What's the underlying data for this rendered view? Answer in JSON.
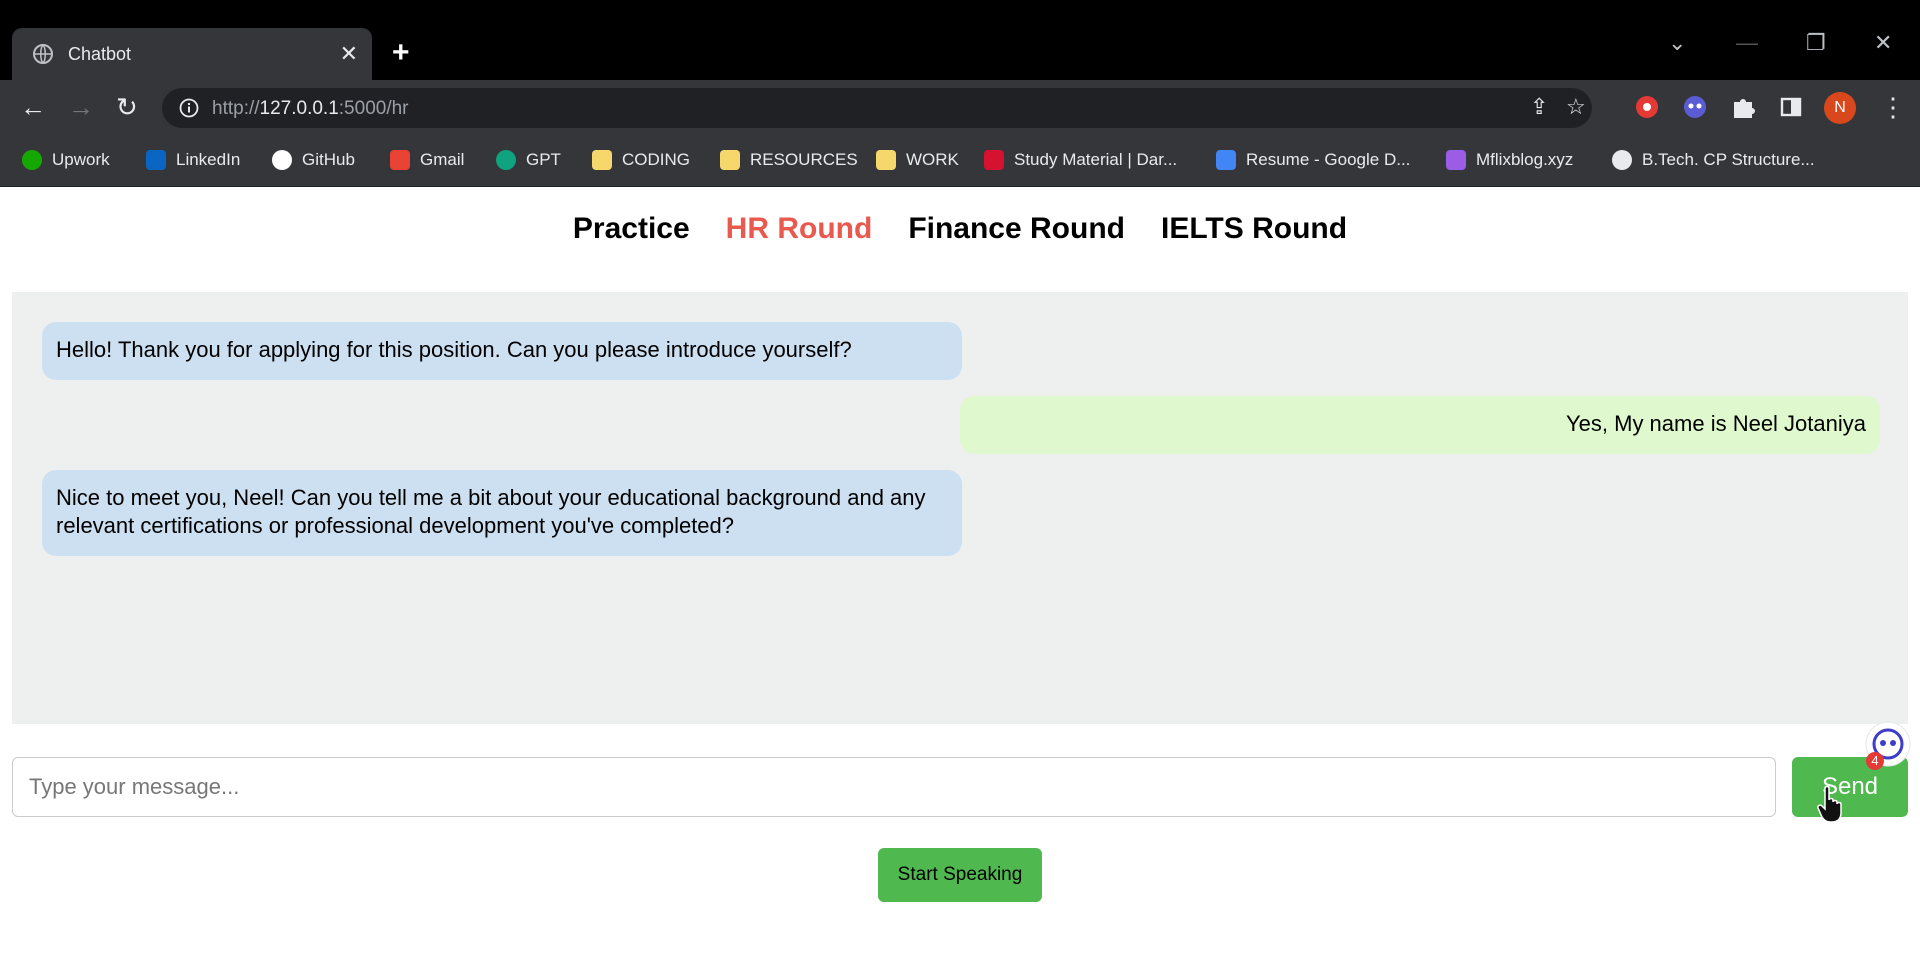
{
  "browser": {
    "tab_title": "Chatbot",
    "tab_close": "✕",
    "new_tab": "+",
    "url_prefix": "http://",
    "url_host": "127.0.0.1",
    "url_rest": ":5000/hr",
    "profile_initial": "N",
    "bookmarks": [
      {
        "label": "Upwork",
        "color": "#14a800"
      },
      {
        "label": "LinkedIn",
        "color": "#0a66c2"
      },
      {
        "label": "GitHub",
        "color": "#ffffff"
      },
      {
        "label": "Gmail",
        "color": "#ea4335"
      },
      {
        "label": "GPT",
        "color": "#10a37f"
      },
      {
        "label": "CODING",
        "color": "#f6d76b"
      },
      {
        "label": "RESOURCES",
        "color": "#f6d76b"
      },
      {
        "label": "WORK",
        "color": "#f6d76b"
      },
      {
        "label": "Study Material | Dar...",
        "color": "#d5122f"
      },
      {
        "label": "Resume - Google D...",
        "color": "#4285f4"
      },
      {
        "label": "Mflixblog.xyz",
        "color": "#9b5de5"
      },
      {
        "label": "B.Tech. CP Structure...",
        "color": "#e8eaed"
      }
    ]
  },
  "nav": {
    "items": [
      "Practice",
      "HR Round",
      "Finance Round",
      "IELTS Round"
    ],
    "active": "HR Round"
  },
  "chat": {
    "messages": [
      {
        "sender": "bot",
        "text": "Hello! Thank you for applying for this position. Can you please introduce yourself?"
      },
      {
        "sender": "user",
        "text": "Yes, My name is Neel Jotaniya"
      },
      {
        "sender": "bot",
        "text": "Nice to meet you, Neel! Can you tell me a bit about your educational background and any relevant certifications or professional development you've completed?"
      }
    ]
  },
  "composer": {
    "placeholder": "Type your message...",
    "send_label": "Send",
    "speak_label": "Start Speaking"
  },
  "assistant_badge": "4",
  "colors": {
    "active_nav": "#e8594e",
    "bot_bubble": "#cde0f1",
    "user_bubble": "#dff8cd",
    "button_green": "#4fb84f"
  }
}
